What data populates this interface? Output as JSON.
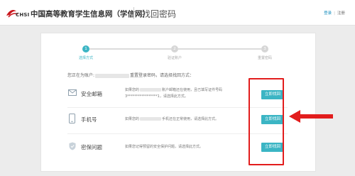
{
  "header": {
    "brand_short": "CHSI",
    "site_title": "中国高等教育学生信息网（学信网）",
    "page_title": "找回密码",
    "login_label": "登录",
    "separator": "|",
    "register_label": "注册"
  },
  "steps": [
    {
      "num": "1",
      "label": "选择方式",
      "active": true
    },
    {
      "num": "2",
      "label": "验证账户",
      "active": false
    },
    {
      "num": "3",
      "label": "重置密码",
      "active": false
    }
  ],
  "intro": {
    "prefix": "您正在为账户:",
    "suffix": "重置登录密码，请选择找回方式："
  },
  "options": [
    {
      "name": "安全邮箱",
      "icon": "mail-icon",
      "desc_line1_prefix": "如果您的",
      "desc_line1_suffix": "账户邮箱还在使用，且已填写证件号码",
      "desc_line2": "3*****************1，请选择此方式。",
      "button": "立即找回"
    },
    {
      "name": "手机号",
      "icon": "phone-icon",
      "desc_line1_prefix": "如果您的",
      "desc_line1_suffix": "手机还在正常使用，请选择此方式。",
      "desc_line2": "",
      "button": "立即找回"
    },
    {
      "name": "密保问题",
      "icon": "shield-icon",
      "desc_line1_prefix": "如果您记得预留的安全保护问题，请选择此方式。",
      "desc_line1_suffix": "",
      "desc_line2": "",
      "button": "立即找回"
    }
  ],
  "colors": {
    "accent": "#3bb5c4",
    "highlight": "#e21d1d",
    "brand_red": "#c9161d"
  }
}
